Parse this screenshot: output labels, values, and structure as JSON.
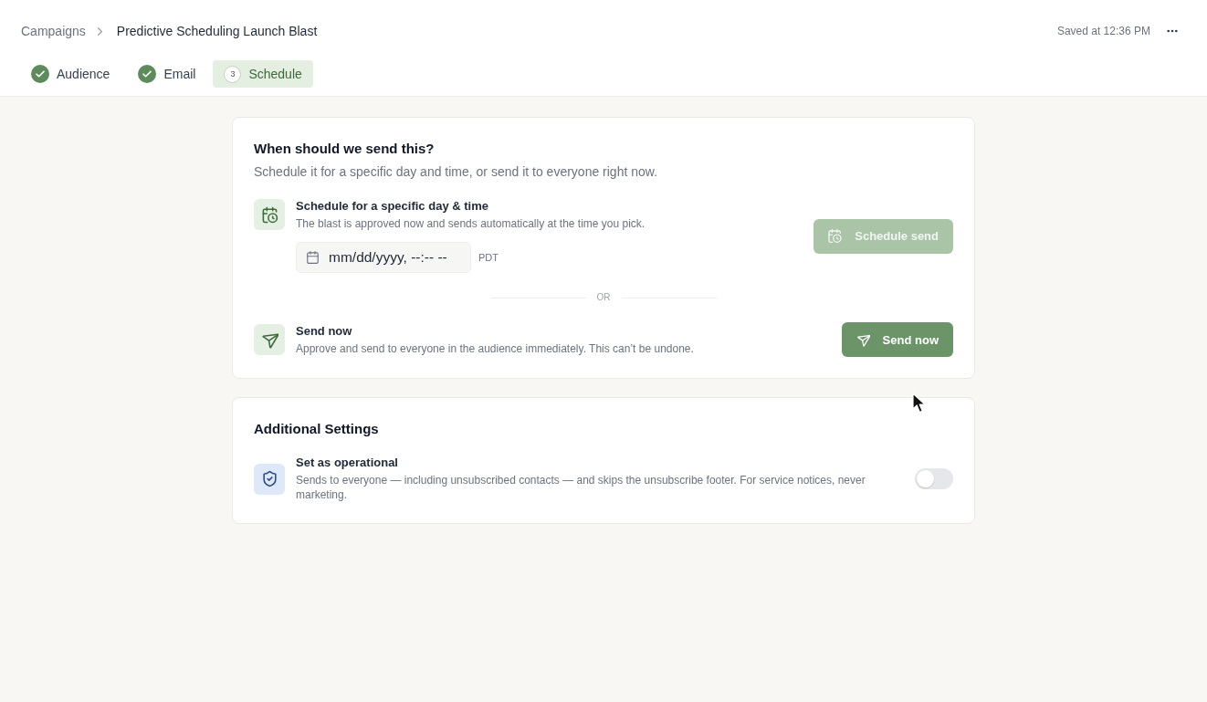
{
  "breadcrumb": {
    "parent": "Campaigns",
    "current": "Predictive Scheduling Launch Blast"
  },
  "save_status": "Saved at 12:36 PM",
  "steps": [
    {
      "label": "Audience",
      "complete": true,
      "selected": false
    },
    {
      "label": "Email",
      "complete": true,
      "selected": false
    },
    {
      "label": "Schedule",
      "number": "3",
      "complete": false,
      "selected": true
    }
  ],
  "send_card": {
    "title": "When should we send this?",
    "subtitle": "Schedule it for a specific day and time, or send it to everyone right now.",
    "schedule": {
      "title": "Schedule for a specific day & time",
      "description": "The blast is approved now and sends automatically at the time you pick.",
      "datetime_field": {
        "placeholder": "mm/dd/yyyy, --:-- --"
      },
      "timezone": "PDT",
      "button": {
        "label": "Schedule send",
        "disabled": true
      }
    },
    "divider": "OR",
    "send_now": {
      "title": "Send now",
      "description": "Approve and send to everyone in the audience immediately. This can’t be undone.",
      "button": {
        "label": "Send now",
        "disabled": false
      }
    }
  },
  "settings_card": {
    "title": "Additional Settings",
    "options": [
      {
        "title": "Set as operational",
        "description": "Sends to everyone — including unsubscribed contacts — and skips the unsubscribe footer. For service notices, never marketing.",
        "on": false
      }
    ]
  }
}
